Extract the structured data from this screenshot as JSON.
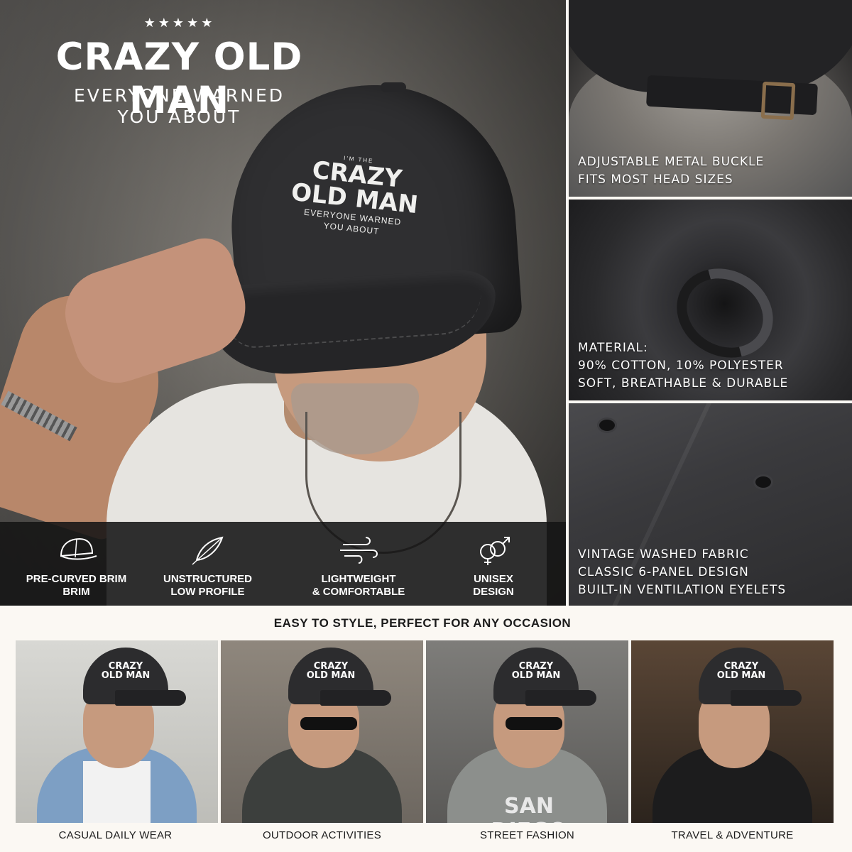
{
  "hero": {
    "stars": "★★★★★",
    "title": "CRAZY OLD MAN",
    "subtitle_line1": "EVERYONE WARNED",
    "subtitle_line2": "YOU ABOUT",
    "cap_small": "I'M THE",
    "cap_line1": "CRAZY",
    "cap_line2": "OLD MAN",
    "cap_sub1": "EVERYONE WARNED",
    "cap_sub2": "YOU ABOUT"
  },
  "features": [
    {
      "icon": "cap-icon",
      "line1": "PRE-CURVED BRIM",
      "line2": "BRIM"
    },
    {
      "icon": "feather-icon",
      "line1": "UNSTRUCTURED",
      "line2": "LOW PROFILE"
    },
    {
      "icon": "wind-icon",
      "line1": "LIGHTWEIGHT",
      "line2": "& COMFORTABLE"
    },
    {
      "icon": "gender-icon",
      "line1": "UNISEX",
      "line2": "DESIGN"
    }
  ],
  "panels": {
    "buckle": {
      "line1": "ADJUSTABLE METAL BUCKLE",
      "line2": "FITS MOST HEAD SIZES"
    },
    "material": {
      "line1": "MATERIAL:",
      "line2": "90% COTTON, 10% POLYESTER",
      "line3": "SOFT, BREATHABLE & DURABLE"
    },
    "fabric": {
      "line1": "VINTAGE WASHED FABRIC",
      "line2": "CLASSIC 6-PANEL DESIGN",
      "line3": "BUILT-IN VENTILATION EYELETS"
    }
  },
  "occasions": {
    "title": "EASY TO STYLE, PERFECT FOR ANY OCCASION",
    "items": [
      {
        "label": "CASUAL DAILY WEAR"
      },
      {
        "label": "OUTDOOR ACTIVITIES"
      },
      {
        "label": "STREET FASHION",
        "shirt_text": "SAN DIEGO"
      },
      {
        "label": "TRAVEL & ADVENTURE"
      }
    ],
    "mini_cap_line1": "CRAZY",
    "mini_cap_line2": "OLD MAN"
  }
}
